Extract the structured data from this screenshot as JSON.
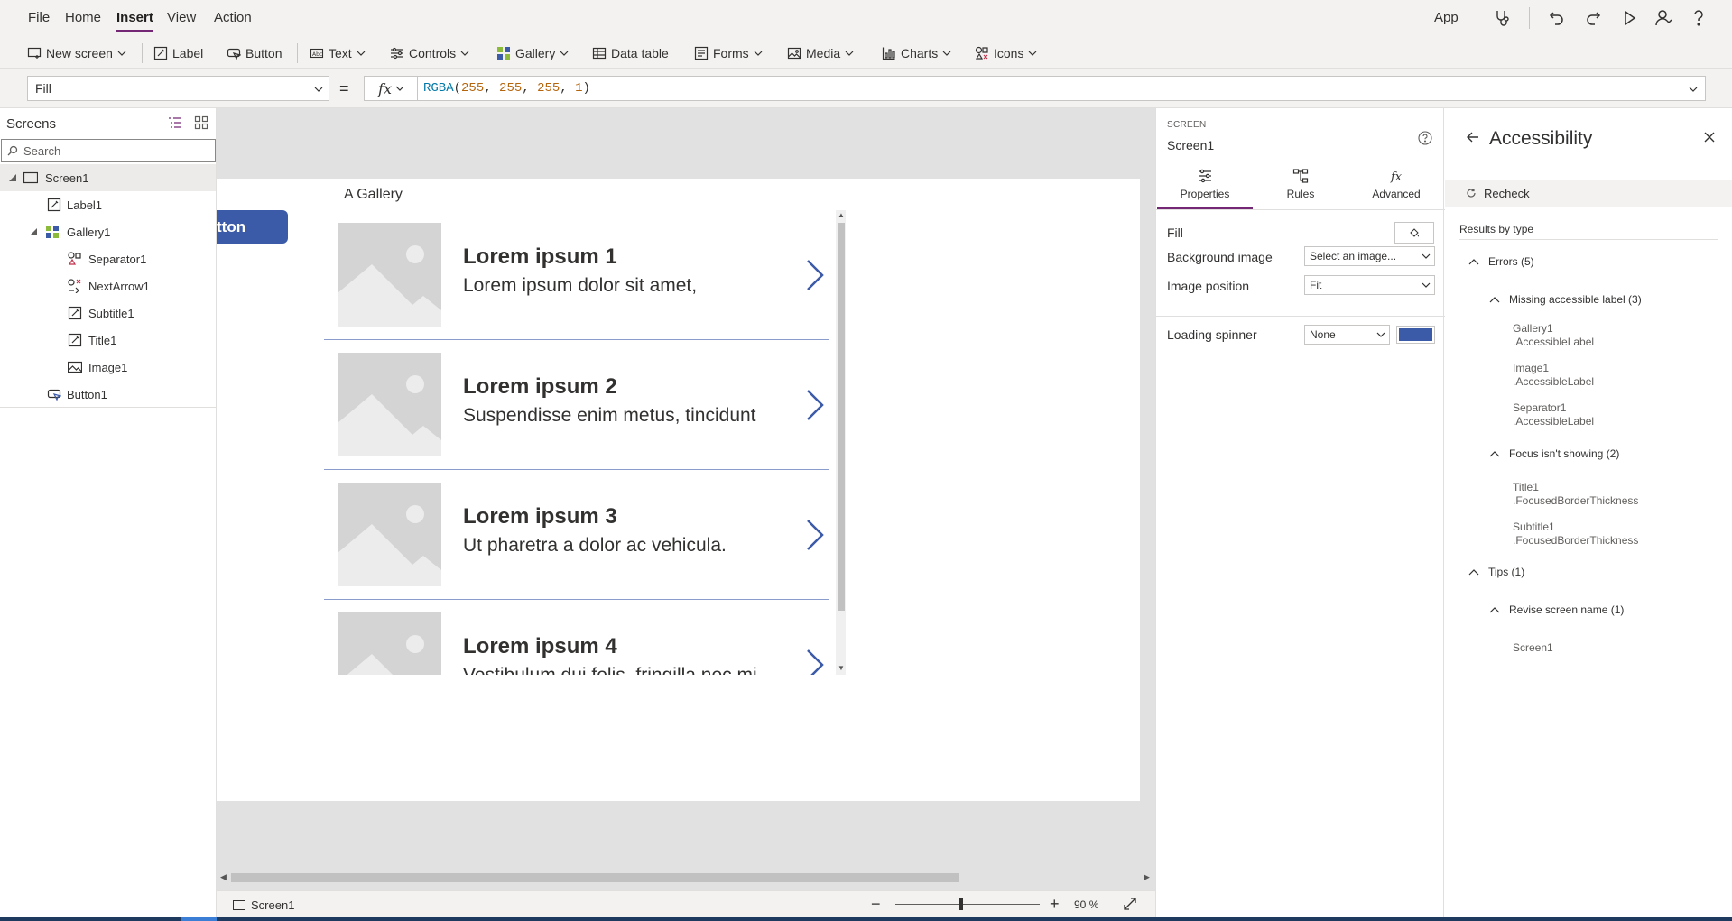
{
  "menu": {
    "items": [
      {
        "label": "File"
      },
      {
        "label": "Home"
      },
      {
        "label": "Insert"
      },
      {
        "label": "View"
      },
      {
        "label": "Action"
      }
    ],
    "active": "Insert",
    "app_label": "App"
  },
  "ribbon": {
    "new_screen": "New screen",
    "label": "Label",
    "button": "Button",
    "text": "Text",
    "controls": "Controls",
    "gallery": "Gallery",
    "data_table": "Data table",
    "forms": "Forms",
    "media": "Media",
    "charts": "Charts",
    "icons": "Icons"
  },
  "formula": {
    "property": "Fill",
    "equals": "=",
    "fx": "fx",
    "fn": "RGBA",
    "open": "(",
    "args": [
      "255",
      "255",
      "255",
      "1"
    ],
    "sep": ", ",
    "close": ")"
  },
  "tree": {
    "title": "Screens",
    "search_placeholder": "Search",
    "items": [
      {
        "label": "Screen1",
        "icon": "screen-icon"
      },
      {
        "label": "Label1",
        "icon": "label-icon"
      },
      {
        "label": "Gallery1",
        "icon": "gallery-icon"
      },
      {
        "label": "Separator1",
        "icon": "separator-icon"
      },
      {
        "label": "NextArrow1",
        "icon": "icon-control-icon"
      },
      {
        "label": "Subtitle1",
        "icon": "label-icon"
      },
      {
        "label": "Title1",
        "icon": "label-icon"
      },
      {
        "label": "Image1",
        "icon": "image-icon"
      },
      {
        "label": "Button1",
        "icon": "button-icon"
      }
    ]
  },
  "canvas": {
    "button_text": "tton",
    "gallery_caption": "A Gallery",
    "gallery_items": [
      {
        "title": "Lorem ipsum 1",
        "subtitle": "Lorem ipsum dolor sit amet,"
      },
      {
        "title": "Lorem ipsum 2",
        "subtitle": "Suspendisse enim metus, tincidunt"
      },
      {
        "title": "Lorem ipsum 3",
        "subtitle": "Ut pharetra a dolor ac vehicula."
      },
      {
        "title": "Lorem ipsum 4",
        "subtitle": "Vestibulum dui felis, fringilla nec mi"
      }
    ]
  },
  "status": {
    "screen": "Screen1",
    "zoom": "90",
    "zoom_unit": "%",
    "zoom_minus": "−",
    "zoom_plus": "+"
  },
  "properties": {
    "type": "SCREEN",
    "name": "Screen1",
    "tabs": [
      {
        "label": "Properties"
      },
      {
        "label": "Rules"
      },
      {
        "label": "Advanced"
      }
    ],
    "fill_label": "Fill",
    "bg_image_label": "Background image",
    "bg_image_value": "Select an image...",
    "image_position_label": "Image position",
    "image_position_value": "Fit",
    "loading_spinner_label": "Loading spinner",
    "loading_spinner_value": "None",
    "spinner_color": "#3b5aa8"
  },
  "accessibility": {
    "title": "Accessibility",
    "recheck": "Recheck",
    "results_by_type": "Results by type",
    "groups": {
      "errors": "Errors (5)",
      "missing_label": "Missing accessible label (3)",
      "focus": "Focus isn't showing (2)",
      "tips": "Tips (1)",
      "revise": "Revise screen name (1)"
    },
    "missing_items": [
      {
        "control": "Gallery1",
        "prop": ".AccessibleLabel"
      },
      {
        "control": "Image1",
        "prop": ".AccessibleLabel"
      },
      {
        "control": "Separator1",
        "prop": ".AccessibleLabel"
      }
    ],
    "focus_items": [
      {
        "control": "Title1",
        "prop": ".FocusedBorderThickness"
      },
      {
        "control": "Subtitle1",
        "prop": ".FocusedBorderThickness"
      }
    ],
    "revise_items": [
      {
        "control": "Screen1"
      }
    ]
  },
  "colors": {
    "accent": "#742774",
    "button_blue": "#3b5aa8",
    "formula_fn": "#0078a8",
    "formula_num": "#b5650d"
  }
}
